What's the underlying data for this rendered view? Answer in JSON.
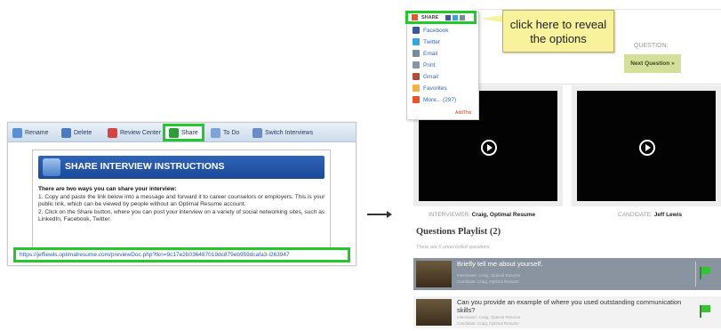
{
  "left": {
    "toolbar": [
      {
        "name": "rename",
        "label": "Rename",
        "color": "#5a8fd6"
      },
      {
        "name": "delete",
        "label": "Delete",
        "color": "#4b7bbf"
      },
      {
        "name": "review-center",
        "label": "Review Center",
        "color": "#d64545"
      },
      {
        "name": "share",
        "label": "Share",
        "color": "#2e9a3a"
      },
      {
        "name": "to-do",
        "label": "To Do",
        "color": "#7da4d9"
      },
      {
        "name": "switch-interviews",
        "label": "Switch Interviews",
        "color": "#6b8cc4"
      }
    ],
    "instructions": {
      "title": "SHARE INTERVIEW INSTRUCTIONS",
      "intro": "There are two ways you can share your interview:",
      "step1": "1. Copy and paste the link below into a message and forward it to career counselors or employers. This is your public link, which can be viewed by people without an Optimal Resume account.",
      "step2": "2. Click on the Share button, where you can post your interview on a variety of social networking sites, such as LinkedIn, Facebook, Twitter.",
      "link": "https://jeffiewls.optimalresume.com/previewDoc.php?tkn=9c17e2b036487019dc879eb959dcafa3-l263947"
    }
  },
  "right": {
    "share_bar_label": "SHARE",
    "share_menu": [
      {
        "label": "Facebook",
        "icon": "facebook-icon",
        "color": "#3b5998"
      },
      {
        "label": "Twitter",
        "icon": "twitter-icon",
        "color": "#33a8df"
      },
      {
        "label": "Email",
        "icon": "email-icon",
        "color": "#7b8a99"
      },
      {
        "label": "Print",
        "icon": "print-icon",
        "color": "#8797a6"
      },
      {
        "label": "Gmail",
        "icon": "gmail-icon",
        "color": "#b24c3c"
      },
      {
        "label": "Favorites",
        "icon": "favorites-icon",
        "color": "#f3b33c"
      },
      {
        "label": "More... (297)",
        "icon": "more-icon",
        "color": "#e8542e"
      }
    ],
    "addthis": "AddThis",
    "callout": "click here to reveal the options",
    "question_label": "QUESTION:",
    "next_button": "Next Question »",
    "interviewer_label": "INTERVIEWER:",
    "interviewer_name": "Craig, Optimal Resume",
    "candidate_label": "CANDIDATE:",
    "candidate_name": "Jeff Lewis",
    "playlist_title": "Questions Playlist (2)",
    "unrecorded": "There are 0 unrecorded questions",
    "questions": [
      {
        "text": "Briefly tell me about yourself.",
        "meta1": "Interviewer: Craig, Optimal Resume",
        "meta2": "Candidate: Craig, Optimal Resume"
      },
      {
        "text": "Can you provide an example of where you used outstanding communication skills?",
        "meta1": "Interviewer: Craig, Optimal Resume",
        "meta2": "Candidate: Craig, Optimal Resume"
      }
    ]
  }
}
